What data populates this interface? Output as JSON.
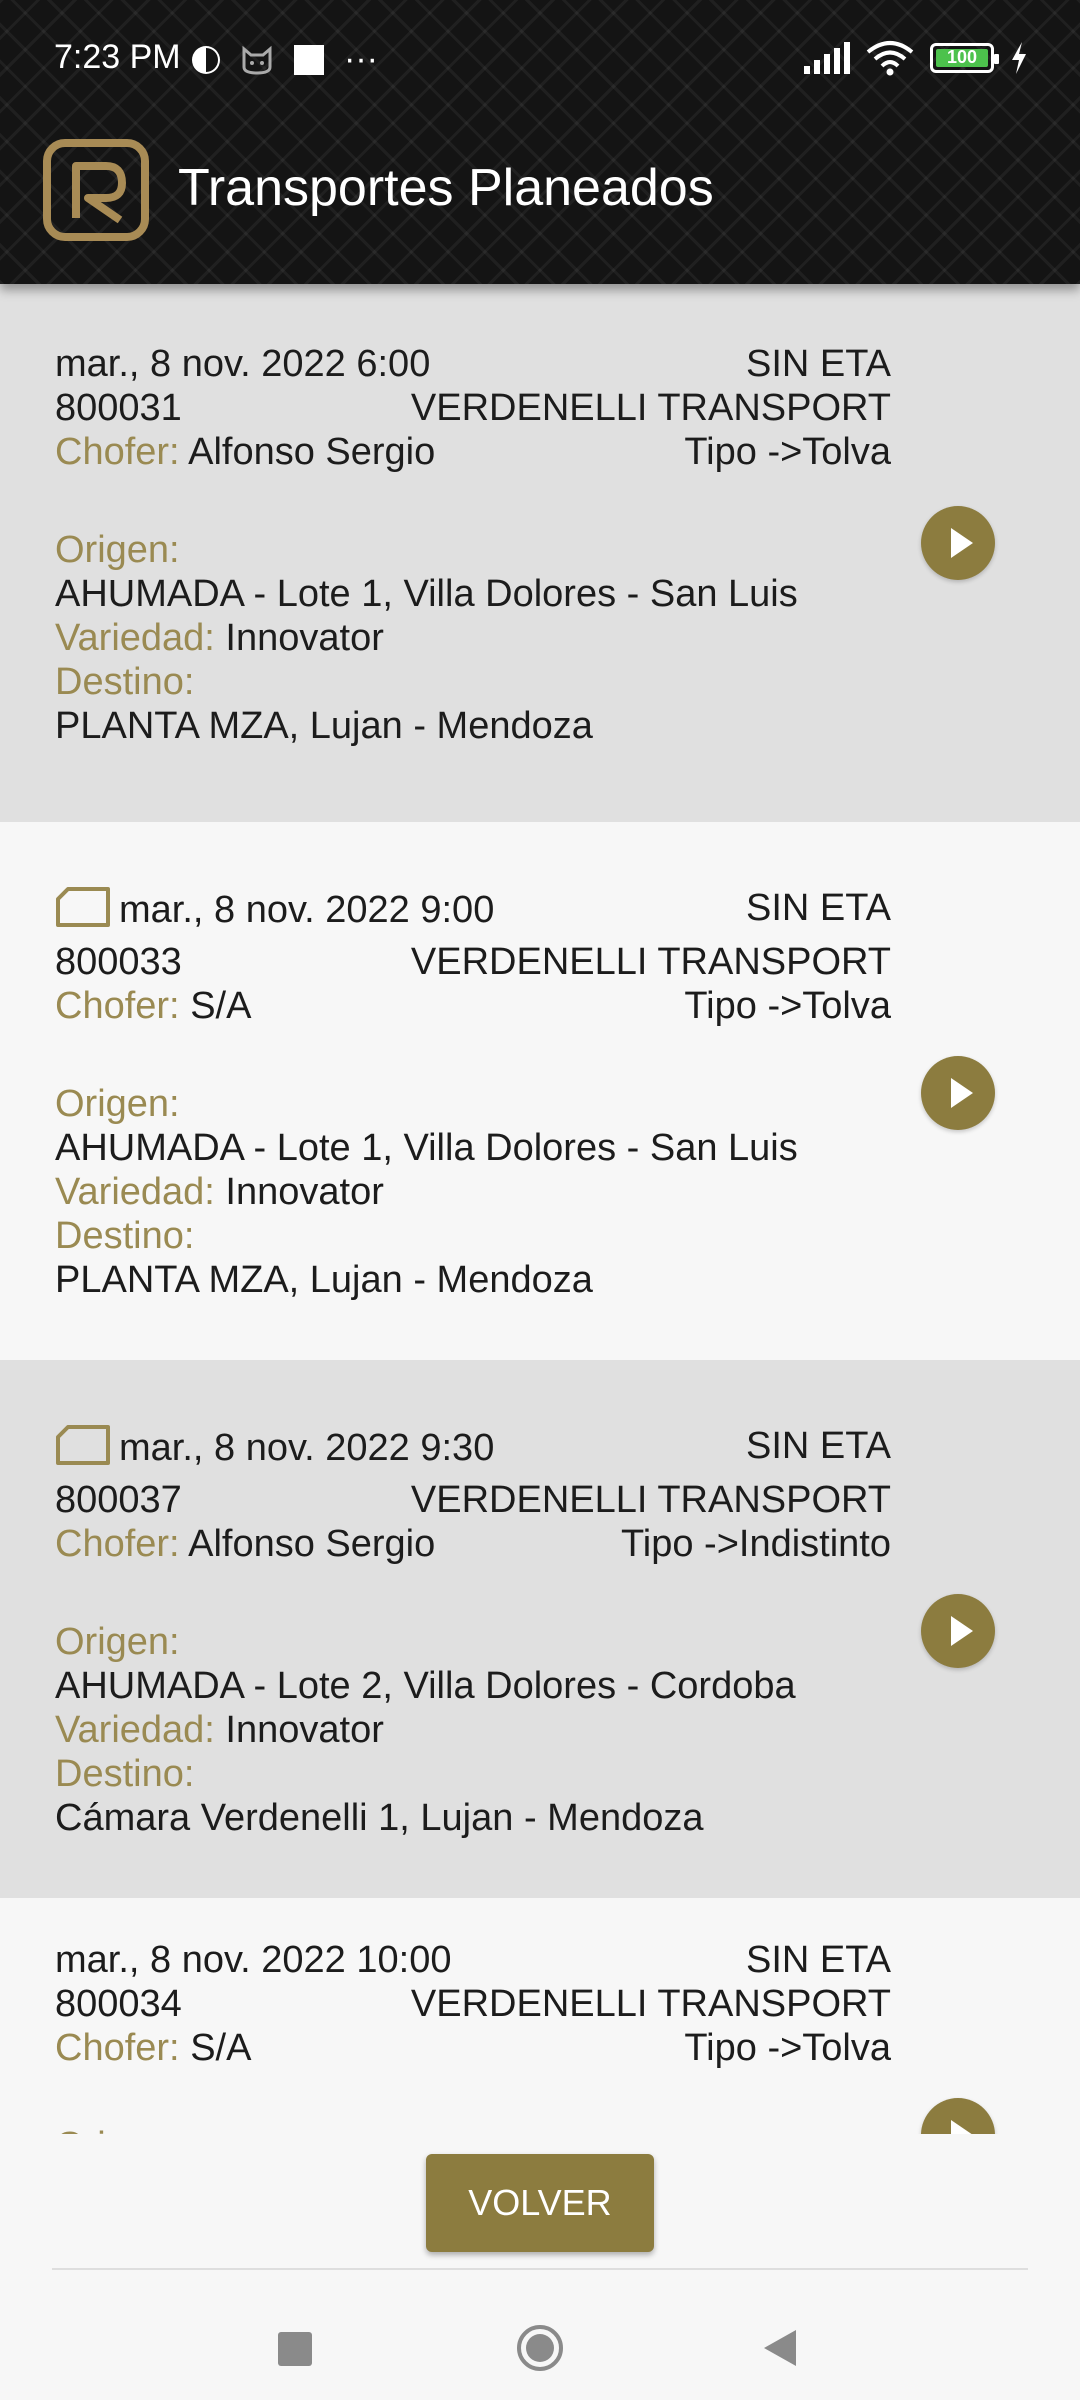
{
  "status": {
    "time": "7:23 PM",
    "dots": "···",
    "battery": "100"
  },
  "header": {
    "title": "Transportes Planeados"
  },
  "labels": {
    "chofer": "Chofer:",
    "origen": "Origen:",
    "variedad": "Variedad:",
    "destino": "Destino:"
  },
  "cards": [
    {
      "date": "mar., 8 nov. 2022 6:00",
      "eta": "SIN ETA",
      "id": "800031",
      "transport": "VERDENELLI TRANSPORT",
      "chofer": "Alfonso Sergio",
      "tipo": "Tipo ->Tolva",
      "origen": "AHUMADA - Lote 1, Villa Dolores - San Luis",
      "variedad": "Innovator",
      "destino": "PLANTA MZA, Lujan - Mendoza"
    },
    {
      "date": "mar., 8 nov. 2022 9:00",
      "eta": "SIN ETA",
      "id": "800033",
      "transport": "VERDENELLI TRANSPORT",
      "chofer": "S/A",
      "tipo": "Tipo ->Tolva",
      "origen": "AHUMADA - Lote 1, Villa Dolores - San Luis",
      "variedad": "Innovator",
      "destino": "PLANTA MZA, Lujan - Mendoza"
    },
    {
      "date": "mar., 8 nov. 2022 9:30",
      "eta": "SIN ETA",
      "id": "800037",
      "transport": "VERDENELLI TRANSPORT",
      "chofer": "Alfonso Sergio",
      "tipo": "Tipo ->Indistinto",
      "origen": "AHUMADA - Lote 2, Villa Dolores - Cordoba",
      "variedad": "Innovator",
      "destino": "Cámara Verdenelli 1, Lujan - Mendoza"
    },
    {
      "date": "mar., 8 nov. 2022 10:00",
      "eta": "SIN ETA",
      "id": "800034",
      "transport": "VERDENELLI TRANSPORT",
      "chofer": "S/A",
      "tipo": "Tipo ->Tolva"
    }
  ],
  "buttons": {
    "volver": "VOLVER"
  },
  "colors": {
    "accent": "#8c7c3f",
    "label": "#9a8a52"
  }
}
